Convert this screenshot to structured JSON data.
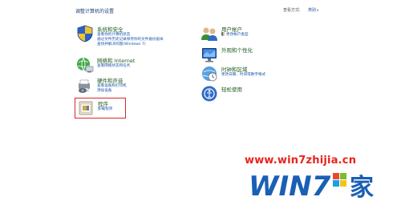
{
  "header": {
    "title": "调整计算机的设置",
    "view_by_label": "查看方式:",
    "view_by_value": "类别",
    "view_by_caret": "▾"
  },
  "left_categories": [
    {
      "title": "系统和安全",
      "icon": "shield-icon",
      "links": [
        "查看你的计算机状态",
        "通过文件历史记录保存你的文件备份副本",
        "查找并解决问题(Windows 7)"
      ]
    },
    {
      "title": "网络和 Internet",
      "icon": "globe-network-icon",
      "links": [
        "查看网络状态和任务"
      ]
    },
    {
      "title": "硬件和声音",
      "icon": "printer-speaker-icon",
      "links": [
        "查看设备和打印机",
        "添加设备"
      ]
    },
    {
      "title": "程序",
      "icon": "programs-icon",
      "links": [
        "卸载程序"
      ]
    }
  ],
  "right_categories": [
    {
      "title": "用户帐户",
      "icon": "users-icon",
      "links": [
        "更改帐户类型"
      ]
    },
    {
      "title": "外观和个性化",
      "icon": "monitor-icon",
      "links": []
    },
    {
      "title": "时钟和区域",
      "icon": "clock-globe-icon",
      "links": [
        "更改日期、时间或数字格式"
      ]
    },
    {
      "title": "轻松使用",
      "icon": "ease-of-access-icon",
      "links": []
    }
  ],
  "watermark": {
    "url": "www.win7zhijia.cn",
    "logo_text": "WIN7",
    "logo_suffix": "家"
  },
  "colors": {
    "highlight": "#d9262a",
    "link_blue": "#1a54a8",
    "heading_green": "#1d5b1d",
    "watermark_red": "#e8231c",
    "logo_blue": "#1a5fb4"
  }
}
